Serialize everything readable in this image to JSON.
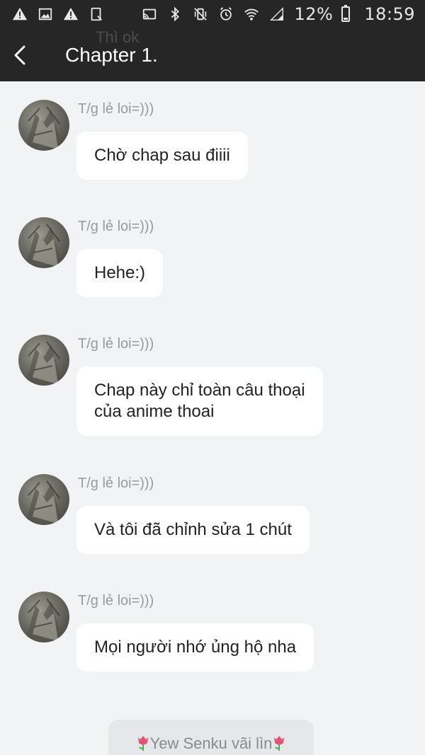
{
  "status_bar": {
    "battery": "12%",
    "time": "18:59",
    "icons_left": [
      "warning-icon",
      "image-icon",
      "warning-icon",
      "tablet-icon"
    ],
    "icons_right": [
      "cast-icon",
      "bluetooth-icon",
      "vibrate-icon",
      "alarm-icon",
      "wifi-icon",
      "signal-icon",
      "battery-icon"
    ]
  },
  "app_bar": {
    "title": "Chapter 1.",
    "ghost": "Thì ok"
  },
  "messages": [
    {
      "sender": "T/g lẻ loi=)))",
      "lines": [
        "Chờ chap sau điiii"
      ]
    },
    {
      "sender": "T/g lẻ loi=)))",
      "lines": [
        "Hehe:)"
      ]
    },
    {
      "sender": "T/g lẻ loi=)))",
      "lines": [
        "Chap này chỉ toàn câu thoại",
        "của anime thoai"
      ]
    },
    {
      "sender": "T/g lẻ loi=)))",
      "lines": [
        "Và tôi đã chỉnh sửa 1 chút"
      ]
    },
    {
      "sender": "T/g lẻ loi=)))",
      "lines": [
        "Mọi người nhớ ủng hộ nha"
      ]
    }
  ],
  "bottom_tag": {
    "text": "Yew Senku vãi lìn"
  },
  "colors": {
    "bar": "#262626",
    "background": "#f2f3f5",
    "bubble": "#ffffff",
    "sender": "#9a9a9a",
    "tulip": "#e05570"
  }
}
